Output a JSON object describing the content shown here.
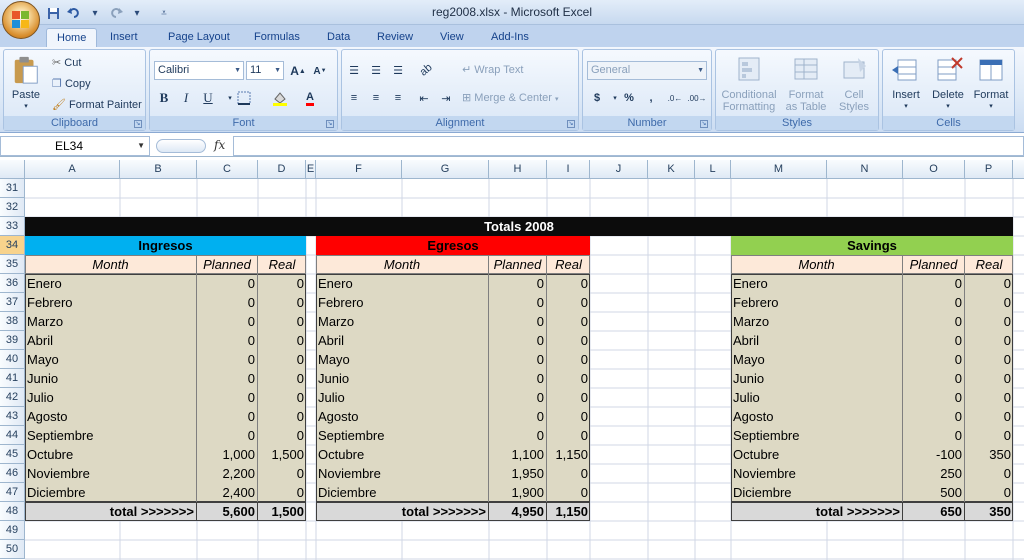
{
  "window": {
    "title": "reg2008.xlsx - Microsoft Excel"
  },
  "ribbon": {
    "tabs": [
      "Home",
      "Insert",
      "Page Layout",
      "Formulas",
      "Data",
      "Review",
      "View",
      "Add-Ins"
    ],
    "clipboard": {
      "paste": "Paste",
      "cut": "Cut",
      "copy": "Copy",
      "format_painter": "Format Painter",
      "label": "Clipboard"
    },
    "font": {
      "name": "Calibri",
      "size": "11",
      "label": "Font",
      "grow": "A",
      "shrink": "A",
      "bold": "B",
      "italic": "I",
      "underline": "U",
      "font_color": "A"
    },
    "alignment": {
      "wrap_text": "Wrap Text",
      "merge_center": "Merge & Center",
      "label": "Alignment"
    },
    "number": {
      "format": "General",
      "currency": "$",
      "percent": "%",
      "comma": ",",
      "label": "Number"
    },
    "styles": {
      "conditional_1": "Conditional",
      "conditional_2": "Formatting",
      "format_table_1": "Format",
      "format_table_2": "as Table",
      "cell_styles_1": "Cell",
      "cell_styles_2": "Styles",
      "label": "Styles"
    },
    "cells": {
      "insert": "Insert",
      "delete": "Delete",
      "format": "Format",
      "label": "Cells"
    }
  },
  "formula_bar": {
    "name_box": "EL34",
    "fx": "fx",
    "formula": ""
  },
  "columns": [
    "A",
    "B",
    "C",
    "D",
    "E",
    "F",
    "G",
    "H",
    "I",
    "J",
    "K",
    "L",
    "M",
    "N",
    "O",
    "P",
    "Q"
  ],
  "rows": [
    "31",
    "32",
    "33",
    "34",
    "35",
    "36",
    "37",
    "38",
    "39",
    "40",
    "41",
    "42",
    "43",
    "44",
    "45",
    "46",
    "47",
    "48",
    "49",
    "50"
  ],
  "sheet": {
    "title": "Totals 2008",
    "colors": {
      "title_bg": "#0c0c0c",
      "ingresos": "#00b0f0",
      "egresos": "#ff0000",
      "savings": "#92d050",
      "header_row": "#fde9d9",
      "body": "#ddd9c4",
      "total": "#d9d9d9"
    },
    "ingresos": {
      "title": "Ingresos",
      "headers": [
        "Month",
        "Planned",
        "Real"
      ],
      "rows": [
        [
          "Enero",
          "0",
          "0"
        ],
        [
          "Febrero",
          "0",
          "0"
        ],
        [
          "Marzo",
          "0",
          "0"
        ],
        [
          "Abril",
          "0",
          "0"
        ],
        [
          "Mayo",
          "0",
          "0"
        ],
        [
          "Junio",
          "0",
          "0"
        ],
        [
          "Julio",
          "0",
          "0"
        ],
        [
          "Agosto",
          "0",
          "0"
        ],
        [
          "Septiembre",
          "0",
          "0"
        ],
        [
          "Octubre",
          "1,000",
          "1,500"
        ],
        [
          "Noviembre",
          "2,200",
          "0"
        ],
        [
          "Diciembre",
          "2,400",
          "0"
        ]
      ],
      "total": [
        "total >>>>>>>",
        "5,600",
        "1,500"
      ]
    },
    "egresos": {
      "title": "Egresos",
      "headers": [
        "Month",
        "Planned",
        "Real"
      ],
      "rows": [
        [
          "Enero",
          "0",
          "0"
        ],
        [
          "Febrero",
          "0",
          "0"
        ],
        [
          "Marzo",
          "0",
          "0"
        ],
        [
          "Abril",
          "0",
          "0"
        ],
        [
          "Mayo",
          "0",
          "0"
        ],
        [
          "Junio",
          "0",
          "0"
        ],
        [
          "Julio",
          "0",
          "0"
        ],
        [
          "Agosto",
          "0",
          "0"
        ],
        [
          "Septiembre",
          "0",
          "0"
        ],
        [
          "Octubre",
          "1,100",
          "1,150"
        ],
        [
          "Noviembre",
          "1,950",
          "0"
        ],
        [
          "Diciembre",
          "1,900",
          "0"
        ]
      ],
      "total": [
        "total >>>>>>>",
        "4,950",
        "1,150"
      ]
    },
    "savings": {
      "title": "Savings",
      "headers": [
        "Month",
        "Planned",
        "Real"
      ],
      "rows": [
        [
          "Enero",
          "0",
          "0"
        ],
        [
          "Febrero",
          "0",
          "0"
        ],
        [
          "Marzo",
          "0",
          "0"
        ],
        [
          "Abril",
          "0",
          "0"
        ],
        [
          "Mayo",
          "0",
          "0"
        ],
        [
          "Junio",
          "0",
          "0"
        ],
        [
          "Julio",
          "0",
          "0"
        ],
        [
          "Agosto",
          "0",
          "0"
        ],
        [
          "Septiembre",
          "0",
          "0"
        ],
        [
          "Octubre",
          "-100",
          "350"
        ],
        [
          "Noviembre",
          "250",
          "0"
        ],
        [
          "Diciembre",
          "500",
          "0"
        ]
      ],
      "total": [
        "total >>>>>>>",
        "650",
        "350"
      ]
    }
  }
}
